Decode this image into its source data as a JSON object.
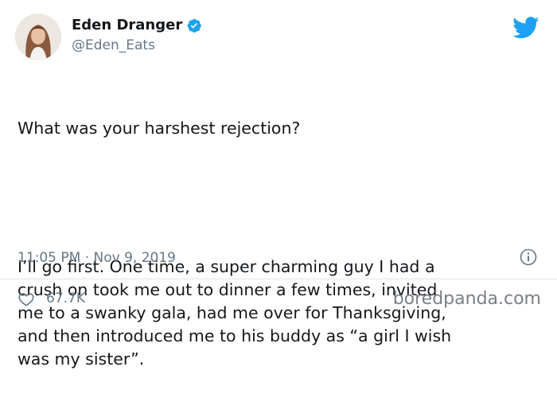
{
  "author": {
    "display_name": "Eden Dranger",
    "handle": "@Eden_Eats",
    "verified_icon": "verified-badge-icon",
    "avatar_icon": "profile-avatar"
  },
  "brand": {
    "icon": "twitter-bird-icon",
    "color": "#1da1f2"
  },
  "tweet": {
    "paragraphs": [
      "What was your harshest rejection?",
      "I’ll go first. One time, a super charming guy I had a\ncrush on took me out to dinner a few times, invited\nme to a swanky gala, had me over for Thanksgiving,\nand then introduced me to his buddy as “a girl I wish\nwas my sister”."
    ],
    "timestamp": "11:05 PM · Nov 9, 2019"
  },
  "actions": {
    "like_icon": "heart-icon",
    "like_count": "67.7K",
    "info_icon": "info-icon"
  },
  "watermark": "boredpanda.com"
}
